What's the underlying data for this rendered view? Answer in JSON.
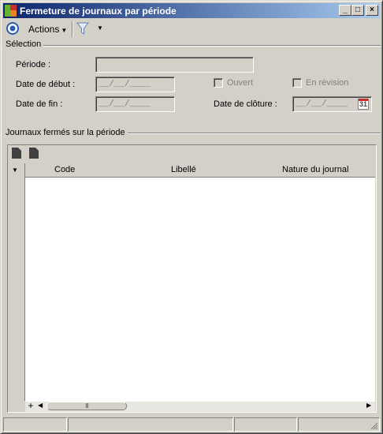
{
  "window": {
    "title": "Fermeture de journaux par période",
    "buttons": {
      "minimize": "_",
      "maximize": "□",
      "close": "×"
    }
  },
  "toolbar": {
    "nav_icon": "circle-target-icon",
    "actions_label": "Actions",
    "filter_icon": "filter-funnel-icon"
  },
  "selection": {
    "section_title": "Sélection",
    "periode_label": "Période :",
    "periode_value": "",
    "date_debut_label": "Date de début :",
    "date_debut_value": "__/__/____",
    "date_fin_label": "Date de fin :",
    "date_fin_value": "__/__/____",
    "ouvert_label": "Ouvert",
    "en_revision_label": "En révision",
    "date_cloture_label": "Date de clôture :",
    "date_cloture_value": "__/__/____",
    "calendar_icon_text": "31"
  },
  "journaux": {
    "section_title": "Journaux fermés sur la période",
    "columns": [
      "Code",
      "Libellé",
      "Nature du journal"
    ],
    "rows": [],
    "add_label": "+",
    "scroll_thumb": "III"
  },
  "status": {
    "panels": [
      "",
      "",
      "",
      ""
    ]
  },
  "colors": {
    "title_start": "#0a246a",
    "title_end": "#a6caf0",
    "face": "#d4d0c8"
  }
}
